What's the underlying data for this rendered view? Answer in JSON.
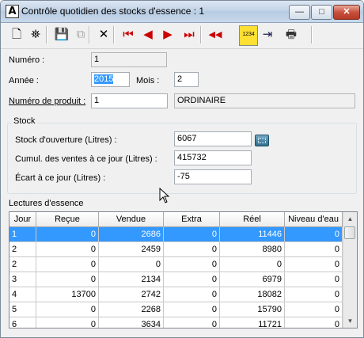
{
  "window": {
    "title": "Contrôle quotidien des stocks d'essence : 1",
    "app_icon_glyph": "A",
    "controls": {
      "minimize": "—",
      "maximize": "□",
      "close": "✕"
    }
  },
  "toolbar": {
    "buttons": [
      {
        "name": "new-icon",
        "glyph": "🗋",
        "enabled": true
      },
      {
        "name": "binoculars-icon",
        "glyph": "⛯",
        "enabled": true
      },
      {
        "name": "save-icon",
        "glyph": "💾",
        "enabled": false
      },
      {
        "name": "copy-icon",
        "glyph": "⧉",
        "enabled": false
      },
      {
        "name": "delete-icon",
        "glyph": "✕",
        "enabled": true
      },
      {
        "name": "first-record-icon",
        "glyph": "⏮",
        "enabled": true
      },
      {
        "name": "previous-record-icon",
        "glyph": "◀",
        "enabled": true
      },
      {
        "name": "next-record-icon",
        "glyph": "▶",
        "enabled": true
      },
      {
        "name": "last-record-icon",
        "glyph": "⏭",
        "enabled": true
      },
      {
        "name": "rewind-icon",
        "glyph": "◀◀",
        "enabled": true
      },
      {
        "name": "numbering-icon",
        "glyph": "1234",
        "enabled": true
      },
      {
        "name": "export-icon",
        "glyph": "⇥",
        "enabled": true
      },
      {
        "name": "print-icon",
        "glyph": "🖶",
        "enabled": true
      }
    ]
  },
  "form": {
    "numero_label": "Numéro :",
    "numero_value": "1",
    "annee_label": "Année :",
    "annee_value": "2015",
    "mois_label": "Mois :",
    "mois_value": "2",
    "produit_label": "Numéro de produit :",
    "produit_value": "1",
    "produit_desc": "ORDINAIRE"
  },
  "stock": {
    "group_label": "Stock",
    "ouverture_label": "Stock d'ouverture (Litres) :",
    "ouverture_value": "6067",
    "cumul_label": "Cumul. des ventes à ce jour (Litres) :",
    "cumul_value": "415732",
    "ecart_label": "Écart à ce jour (Litres) :",
    "ecart_value": "-75"
  },
  "lectures": {
    "label": "Lectures d'essence",
    "columns": [
      "Jour",
      "Reçue",
      "Vendue",
      "Extra",
      "Réel",
      "Niveau d'eau"
    ],
    "rows": [
      [
        "1",
        "0",
        "2686",
        "0",
        "11446",
        "0"
      ],
      [
        "2",
        "0",
        "2459",
        "0",
        "8980",
        "0"
      ],
      [
        "2",
        "0",
        "0",
        "0",
        "0",
        "0"
      ],
      [
        "3",
        "0",
        "2134",
        "0",
        "6979",
        "0"
      ],
      [
        "4",
        "13700",
        "2742",
        "0",
        "18082",
        "0"
      ],
      [
        "5",
        "0",
        "2268",
        "0",
        "15790",
        "0"
      ],
      [
        "6",
        "0",
        "3634",
        "0",
        "11721",
        "0"
      ]
    ],
    "selected_row": 0
  }
}
